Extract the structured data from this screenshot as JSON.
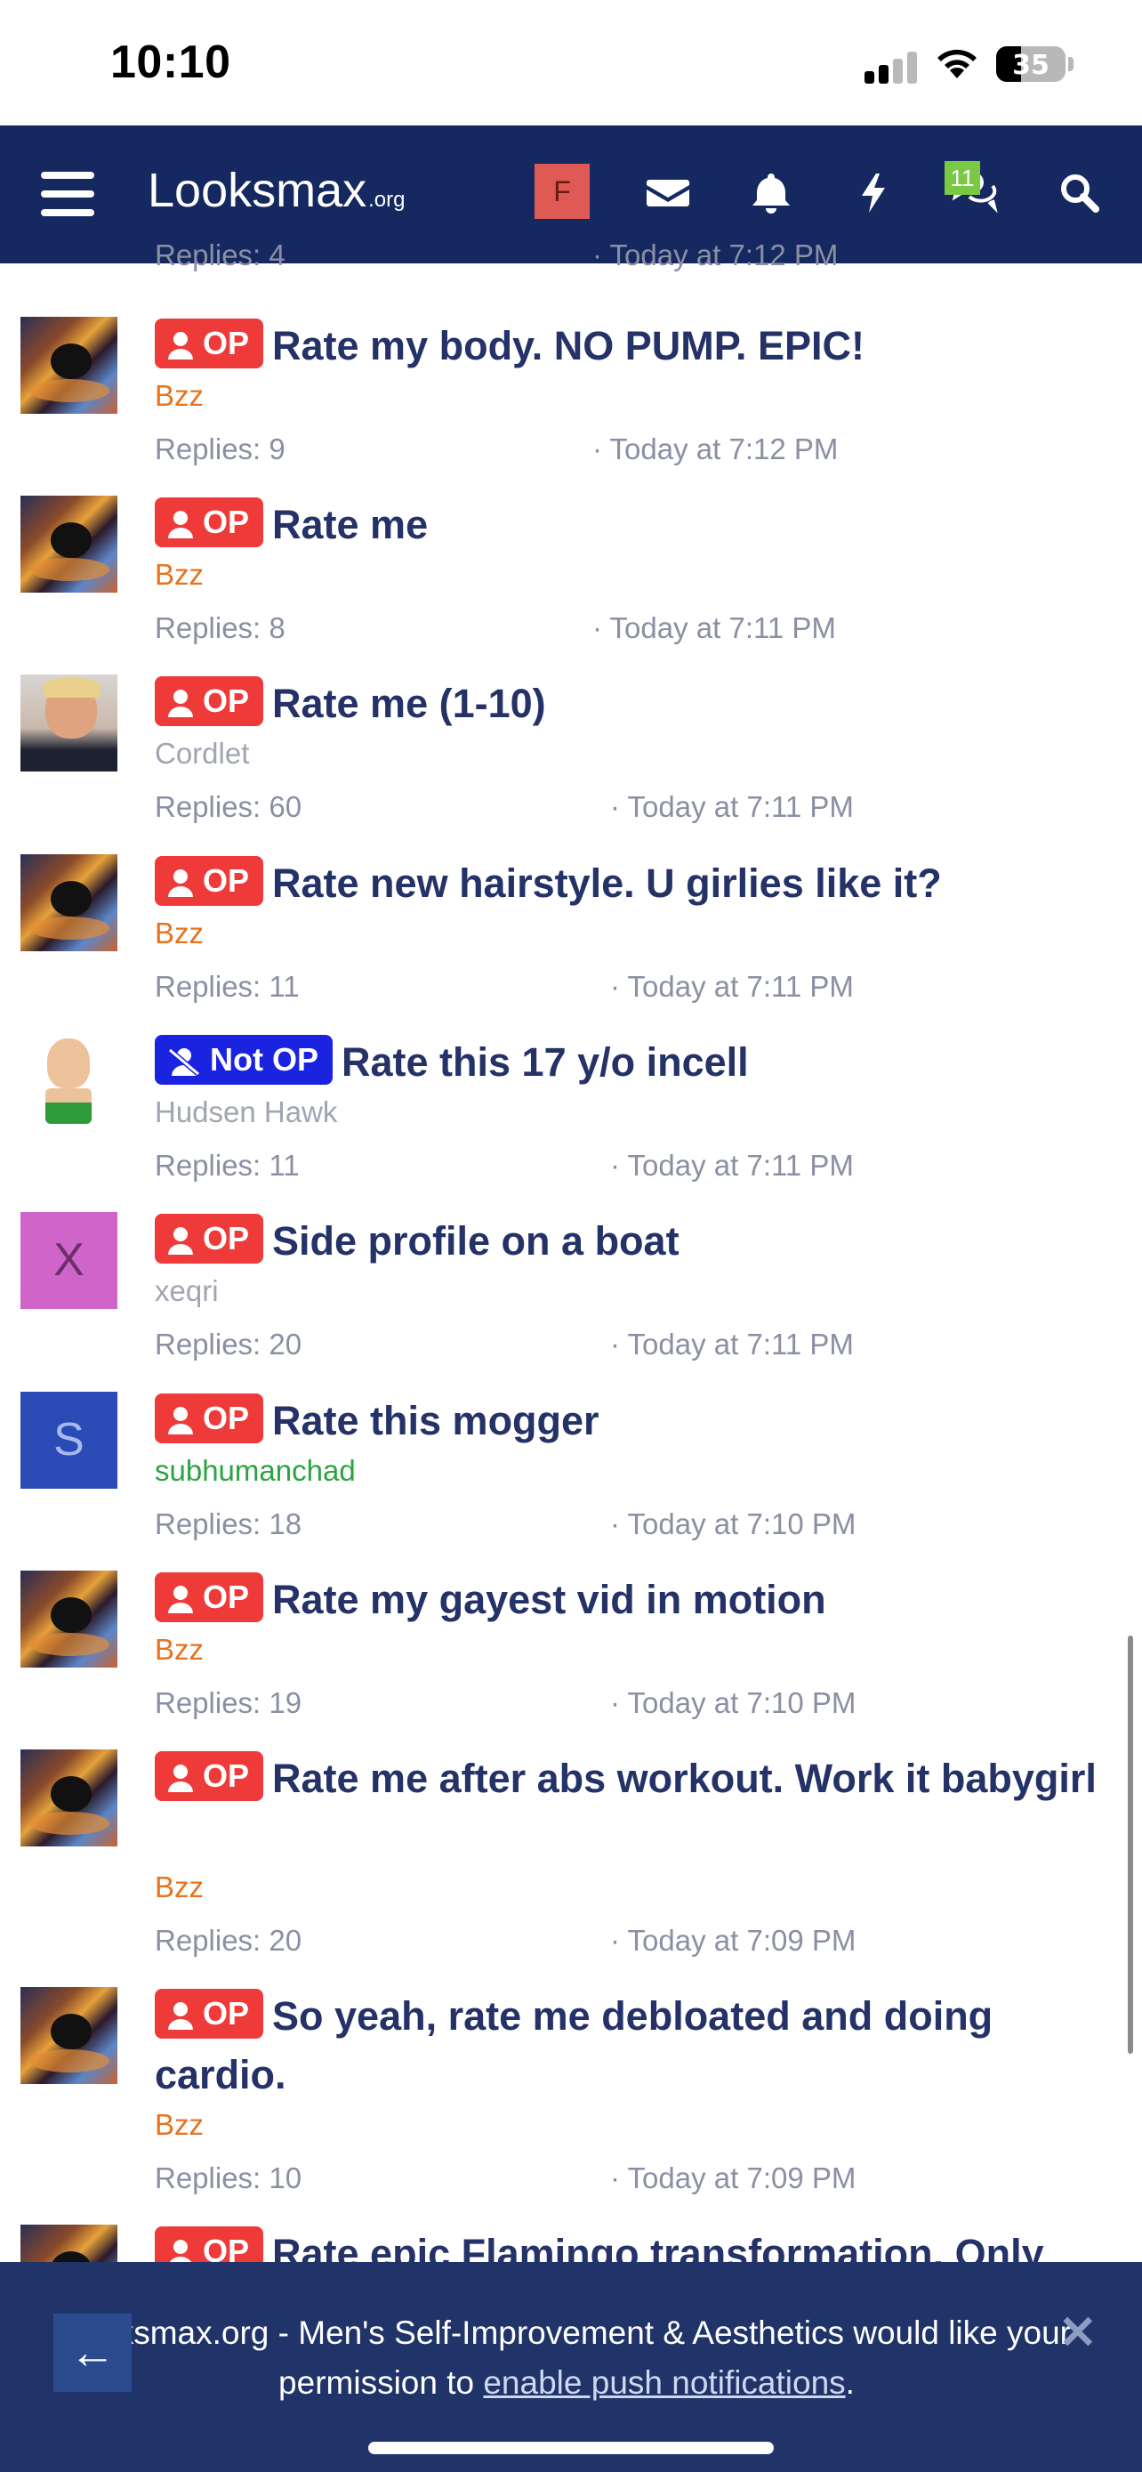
{
  "status_bar": {
    "time": "10:10",
    "battery": "35"
  },
  "navbar": {
    "logo_main": "Looksmax",
    "logo_suffix": ".org",
    "avatar_letter": "F",
    "conversations_badge": "11"
  },
  "partial_top": {
    "replies": "Replies: 4",
    "date": "· Today at 7:12 PM"
  },
  "threads": [
    {
      "prefix": "OP",
      "title": "Rate my body. NO PUMP. EPIC!",
      "author": "Bzz",
      "replies": "Replies: 9",
      "date": "· Today at 7:12 PM"
    },
    {
      "prefix": "OP",
      "title": "Rate me",
      "author": "Bzz",
      "replies": "Replies: 8",
      "date": "· Today at 7:11 PM"
    },
    {
      "prefix": "OP",
      "title": "Rate me (1-10)",
      "author": "Cordlet",
      "replies": "Replies: 60",
      "date": "· Today at 7:11 PM"
    },
    {
      "prefix": "OP",
      "title": "Rate new hairstyle. U girlies like it?",
      "author": "Bzz",
      "replies": "Replies: 11",
      "date": "· Today at 7:11 PM"
    },
    {
      "prefix": "Not OP",
      "title": "Rate this 17 y/o incell",
      "author": "Hudsen Hawk",
      "replies": "Replies: 11",
      "date": "· Today at 7:11 PM"
    },
    {
      "prefix": "OP",
      "title": "Side profile on a boat",
      "author": "xeqri",
      "avatar_letter": "X",
      "replies": "Replies: 20",
      "date": "· Today at 7:11 PM"
    },
    {
      "prefix": "OP",
      "title": "Rate this mogger",
      "author": "subhumanchad",
      "avatar_letter": "S",
      "replies": "Replies: 18",
      "date": "· Today at 7:10 PM"
    },
    {
      "prefix": "OP",
      "title": "Rate my gayest vid in motion",
      "author": "Bzz",
      "replies": "Replies: 19",
      "date": "· Today at 7:10 PM"
    },
    {
      "prefix": "OP",
      "title": "Rate me after abs workout. Work it babygirl",
      "author": "Bzz",
      "replies": "Replies: 20",
      "date": "· Today at 7:09 PM"
    },
    {
      "prefix": "OP",
      "title": "So yeah, rate me debloated and doing cardio.",
      "author": "Bzz",
      "replies": "Replies: 10",
      "date": "· Today at 7:09 PM"
    },
    {
      "prefix": "OP",
      "title": "Rate epic Flamingo transformation. Only"
    }
  ],
  "push_banner": {
    "text_before": "Looksmax.org - Men's Self-Improvement & Aesthetics would like your permission to",
    "link_text": "enable push notifications",
    "text_after": ".",
    "close": "✕",
    "back": "←"
  },
  "colors": {
    "navbar": "#15285f",
    "op_pill": "#ef3a3a",
    "not_op_pill": "#1a23e0",
    "title": "#243268",
    "author_orange": "#e8731e",
    "author_green": "#2ca341",
    "banner": "#203469"
  }
}
